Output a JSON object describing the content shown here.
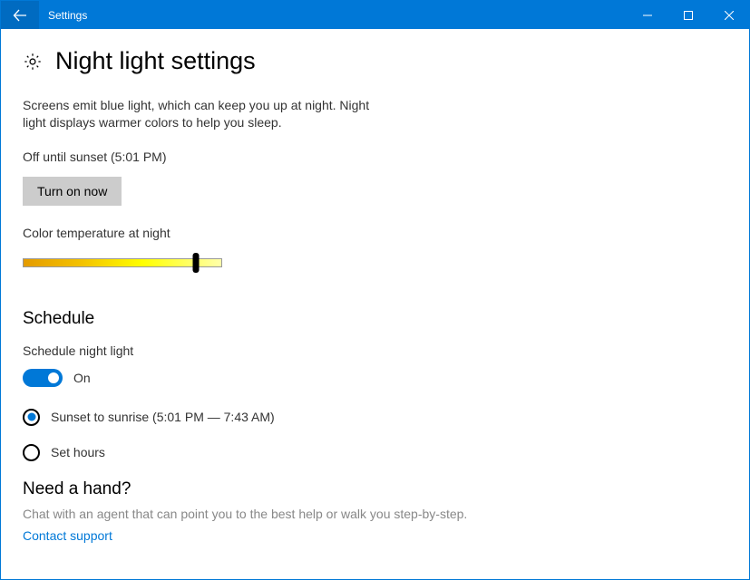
{
  "titlebar": {
    "app_title": "Settings"
  },
  "page": {
    "title": "Night light settings",
    "description": "Screens emit blue light, which can keep you up at night. Night light displays warmer colors to help you sleep.",
    "status": "Off until sunset (5:01 PM)",
    "turn_on_label": "Turn on now",
    "temp_label": "Color temperature at night",
    "temp_slider_percent": 87
  },
  "schedule": {
    "heading": "Schedule",
    "toggle_label": "Schedule night light",
    "toggle_state": "On",
    "options": {
      "sunset": "Sunset to sunrise (5:01 PM — 7:43 AM)",
      "sethours": "Set hours"
    }
  },
  "help": {
    "heading": "Need a hand?",
    "text": "Chat with an agent that can point you to the best help or walk you step-by-step.",
    "link": "Contact support"
  }
}
